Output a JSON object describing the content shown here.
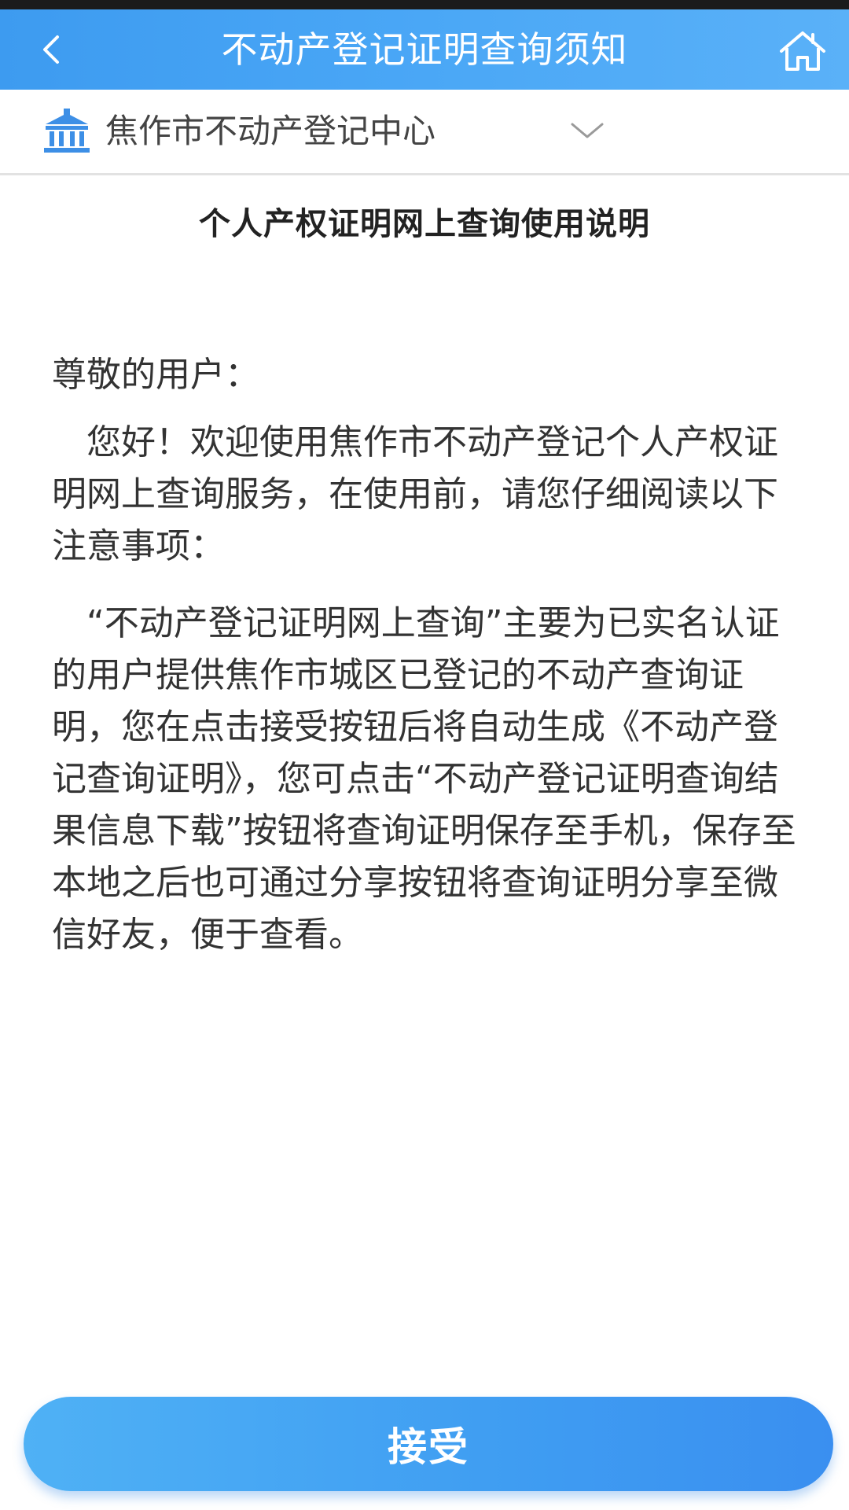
{
  "header": {
    "title": "不动产登记证明查询须知",
    "back_icon": "chevron-left-icon",
    "home_icon": "home-icon",
    "bg_color": "#4aa7f6"
  },
  "org_selector": {
    "icon": "government-building-icon",
    "name": "焦作市不动产登记中心",
    "dropdown_icon": "chevron-down-icon"
  },
  "notice": {
    "title": "个人产权证明网上查询使用说明",
    "greeting": "尊敬的用户：",
    "paragraphs": [
      "您好！欢迎使用焦作市不动产登记个人产权证明网上查询服务，在使用前，请您仔细阅读以下注意事项：",
      "“不动产登记证明网上查询”主要为已实名认证的用户提供焦作市城区已登记的不动产查询证明，您在点击接受按钮后将自动生成《不动产登记查询证明》，您可点击“不动产登记证明查询结果信息下载”按钮将查询证明保存至手机，保存至本地之后也可通过分享按钮将查询证明分享至微信好友，便于查看。"
    ]
  },
  "footer": {
    "accept_label": "接受",
    "accent_color": "#3f9df2"
  }
}
